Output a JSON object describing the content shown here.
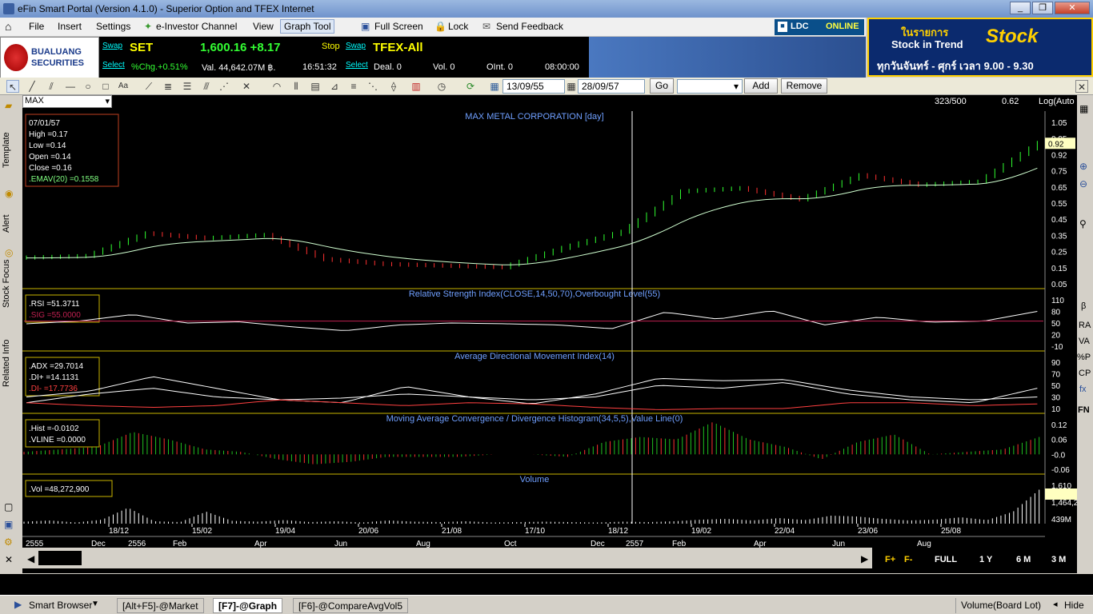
{
  "window": {
    "title": "eFin Smart Portal (Version 4.1.0) - Superior Option and TFEX Internet"
  },
  "menu": [
    "File",
    "Insert",
    "Settings",
    "e-Investor Channel",
    "View",
    "Graph Tool",
    "Full Screen",
    "Lock",
    "Send Feedback"
  ],
  "ldc": {
    "label": "LDC",
    "status": "ONLINE"
  },
  "logo": {
    "line1": "BUALUANG",
    "line2": "SECURITIES"
  },
  "set": {
    "swap": "Swap",
    "select": "Select",
    "name": "SET",
    "value": "1,600.16 +8.17",
    "chg": "%Chg.+0.51%",
    "val": "Val. 44,642.07M ฿.",
    "time": "16:51:32"
  },
  "tfex": {
    "stop": "Stop",
    "swap": "Swap",
    "select": "Select",
    "name": "TFEX-All",
    "deal": "Deal. 0",
    "vol": "Vol. 0",
    "oint": "OInt. 0",
    "time": "08:00:00"
  },
  "ad": {
    "line1": "ในรายการ",
    "line2": "Stock in Trend",
    "brand": "Stock",
    "sub": "ทุกวันจันทร์ - ศุกร์ เวลา 9.00 - 9.30"
  },
  "toolbar": {
    "from": "13/09/55",
    "to": "28/09/57",
    "go": "Go",
    "add": "Add",
    "remove": "Remove"
  },
  "side_tabs": [
    "Template",
    "Alert",
    "Stock Focus",
    "Related Info"
  ],
  "chart_head": {
    "symbol": "MAX",
    "count": "323/500",
    "price": "0.62",
    "scale": "Log(Auto"
  },
  "chart_data": [
    {
      "type": "candlestick",
      "title": "MAX METAL CORPORATION [day]",
      "info": [
        "07/01/57",
        "High  =0.17",
        "Low  =0.14",
        "Open  =0.14",
        "Close  =0.16",
        ".EMAV(20)   =0.1558"
      ],
      "yticks": [
        "1.05",
        "0.95",
        "0.92",
        "0.75",
        "0.65",
        "0.55",
        "0.45",
        "0.35",
        "0.25",
        "0.15",
        "0.05"
      ],
      "last": "0.92",
      "x": [
        "13/09/55",
        "18/12/55",
        "15/02/56",
        "19/04/56",
        "20/06/56",
        "21/08/56",
        "17/10/56",
        "18/12/56",
        "19/02/57",
        "22/04/57",
        "23/06/57",
        "25/08/57",
        "28/09/57"
      ],
      "close": [
        0.21,
        0.22,
        0.36,
        0.33,
        0.35,
        0.2,
        0.17,
        0.16,
        0.15,
        0.27,
        0.37,
        0.62,
        0.64,
        0.57,
        0.72,
        0.66,
        0.68,
        0.92
      ]
    },
    {
      "type": "line",
      "title": "Relative Strength Index(CLOSE,14,50,70),Overbought Level(55)",
      "info": [
        ".RSI  =51.3711",
        ".SIG  =55.0000"
      ],
      "yticks": [
        "110",
        "80",
        "50",
        "20",
        "-10"
      ],
      "series": [
        {
          "name": "RSI",
          "values": [
            48,
            55,
            72,
            50,
            53,
            40,
            30,
            45,
            50,
            48,
            45,
            35,
            78,
            60,
            82,
            45,
            65,
            52,
            55,
            80
          ]
        }
      ]
    },
    {
      "type": "line",
      "title": "Average Directional Movement Index(14)",
      "info": [
        ".ADX  =29.7014",
        ".DI+  =14.1131",
        ".DI-  =17.7736"
      ],
      "yticks": [
        "90",
        "70",
        "50",
        "30",
        "10"
      ],
      "series": [
        {
          "name": "ADX",
          "values": [
            30,
            40,
            65,
            45,
            25,
            20,
            48,
            30,
            18,
            35,
            62,
            58,
            60,
            42,
            30,
            25,
            30
          ]
        },
        {
          "name": "DI+",
          "values": [
            20,
            35,
            45,
            30,
            25,
            28,
            35,
            30,
            25,
            30,
            50,
            45,
            55,
            35,
            25,
            20,
            45
          ]
        },
        {
          "name": "DI-",
          "values": [
            20,
            15,
            12,
            15,
            25,
            20,
            15,
            20,
            18,
            12,
            8,
            10,
            10,
            20,
            20,
            15,
            18
          ]
        }
      ]
    },
    {
      "type": "bar",
      "title": "Moving Average Convergence / Divergence Histogram(34,5,5),Value Line(0)",
      "info": [
        ".Hist  =-0.0102",
        ".VLINE  =0.0000"
      ],
      "yticks": [
        "0.12",
        "0.06",
        "-0.0",
        "-0.06"
      ],
      "values": [
        0.01,
        0.02,
        0.03,
        0.09,
        0.06,
        0.02,
        0.01,
        -0.02,
        -0.04,
        -0.03,
        -0.01,
        -0.01,
        -0.01,
        0.0,
        0.0,
        -0.01,
        0.05,
        0.07,
        0.06,
        0.13,
        0.06,
        0.03,
        -0.02,
        0.05,
        0.08,
        0.0,
        0.01,
        0.02,
        0.07
      ]
    },
    {
      "type": "bar",
      "title": "Volume",
      "info": [
        ".Vol  =48,272,900"
      ],
      "yticks": [
        "1,610",
        "1,464,2",
        "439M"
      ],
      "values": [
        5,
        8,
        3,
        10,
        40,
        6,
        4,
        30,
        7,
        5,
        9,
        4,
        6,
        3,
        8,
        5,
        4,
        6,
        3,
        4,
        5,
        4,
        3,
        5,
        4,
        6,
        10,
        12,
        8,
        14,
        9,
        20,
        18,
        12,
        8,
        10,
        16,
        9,
        30,
        85
      ]
    }
  ],
  "xaxis": {
    "dates": [
      "18/12",
      "15/02",
      "19/04",
      "20/06",
      "21/08",
      "17/10",
      "18/12",
      "19/02",
      "22/04",
      "23/06",
      "25/08"
    ],
    "months": [
      "2555",
      "Dec",
      "2556",
      "Feb",
      "Apr",
      "Jun",
      "Aug",
      "Oct",
      "Dec",
      "2557",
      "Feb",
      "Apr",
      "Jun",
      "Aug"
    ]
  },
  "zoom": [
    "F+",
    "F-",
    "FULL",
    "1 Y",
    "6 M",
    "3 M"
  ],
  "rightbar": [
    "β",
    "RA",
    "VA",
    "%P",
    "CP",
    "fx",
    "FN"
  ],
  "taskbar": {
    "browser": "Smart Browser",
    "tabs": [
      "[Alt+F5]-@Market",
      "[F7]-@Graph",
      "[F6]-@CompareAvgVol5"
    ],
    "vol_mode": "Volume(Board Lot)",
    "hide": "Hide"
  }
}
